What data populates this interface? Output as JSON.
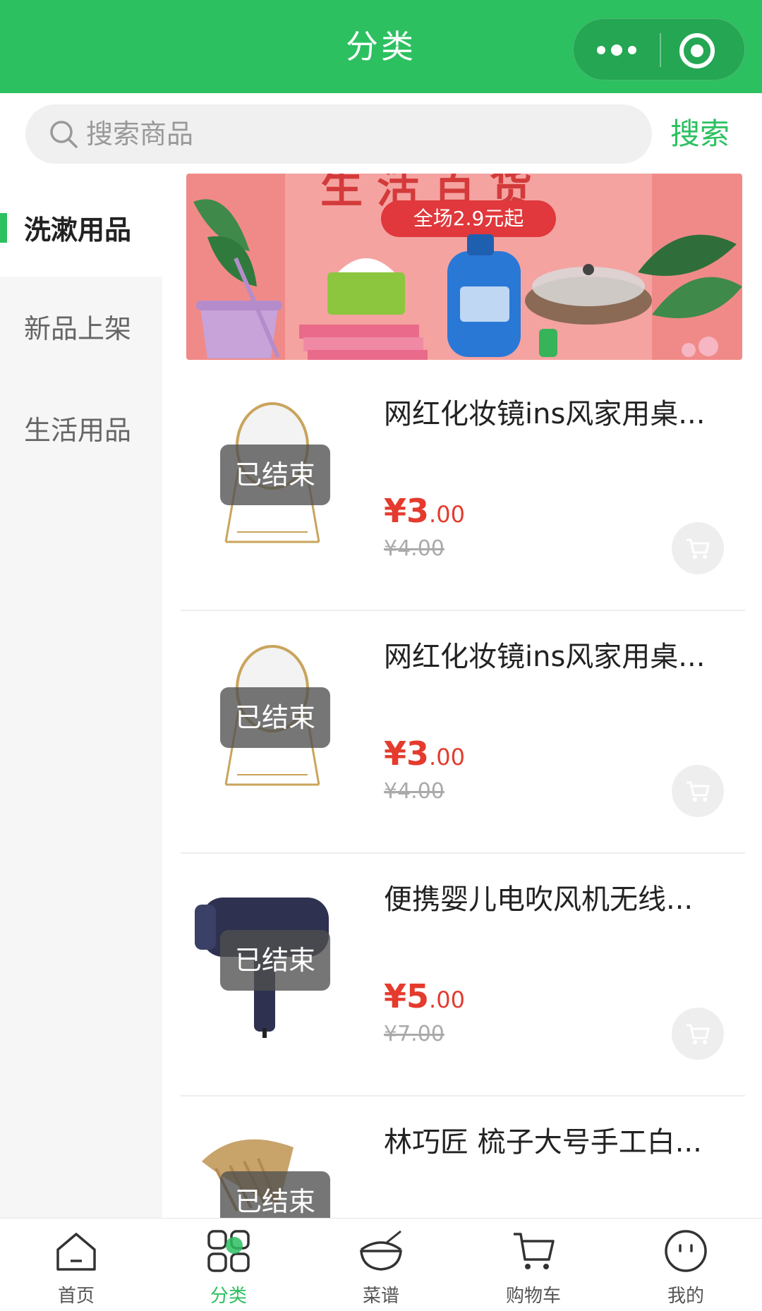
{
  "header": {
    "title": "分类"
  },
  "search": {
    "placeholder": "搜索商品",
    "button_label": "搜索"
  },
  "sidebar": {
    "items": [
      {
        "label": "洗漱用品",
        "active": true
      },
      {
        "label": "新品上架",
        "active": false
      },
      {
        "label": "生活用品",
        "active": false
      }
    ]
  },
  "banner": {
    "headline": "生活百货",
    "promo": "全场2.9元起"
  },
  "products": [
    {
      "title": "网红化妆镜ins风家用桌...",
      "status": "已结束",
      "price_symbol": "¥",
      "price_int": "3",
      "price_dec": ".00",
      "price_old": "¥4.00",
      "image": "mirror"
    },
    {
      "title": "网红化妆镜ins风家用桌...",
      "status": "已结束",
      "price_symbol": "¥",
      "price_int": "3",
      "price_dec": ".00",
      "price_old": "¥4.00",
      "image": "mirror"
    },
    {
      "title": "便携婴儿电吹风机无线...",
      "status": "已结束",
      "price_symbol": "¥",
      "price_int": "5",
      "price_dec": ".00",
      "price_old": "¥7.00",
      "image": "hair-dryer"
    },
    {
      "title": "林巧匠 梳子大号手工白...",
      "status": "已结束",
      "image": "comb"
    }
  ],
  "tabbar": {
    "items": [
      {
        "label": "首页",
        "icon": "home-icon",
        "active": false
      },
      {
        "label": "分类",
        "icon": "category-icon",
        "active": true
      },
      {
        "label": "菜谱",
        "icon": "recipe-bowl-icon",
        "active": false
      },
      {
        "label": "购物车",
        "icon": "cart-icon",
        "active": false
      },
      {
        "label": "我的",
        "icon": "profile-face-icon",
        "active": false
      }
    ]
  },
  "colors": {
    "brand": "#2cc060",
    "price": "#e43b2e",
    "sidebar_bg": "#f6f6f6"
  }
}
